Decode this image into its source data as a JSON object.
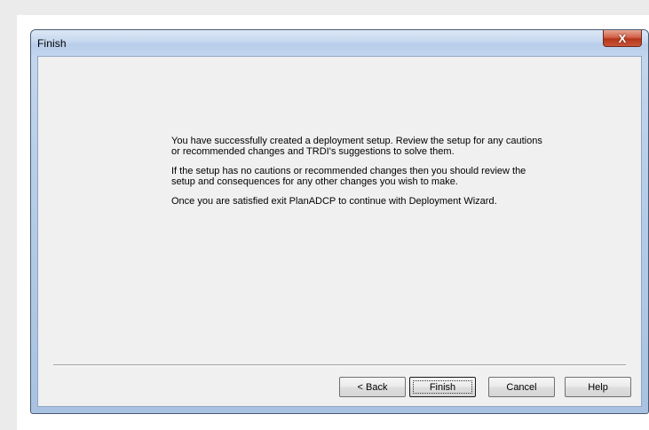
{
  "window": {
    "title": "Finish",
    "close_glyph": "X"
  },
  "message": {
    "paragraph1": "You have successfully created a deployment setup.   Review the setup for any cautions or recommended changes and TRDI's suggestions to solve them.",
    "paragraph2": "If the setup has no cautions or recommended changes then you should review the setup and consequences for any other changes you wish to make.",
    "paragraph3": "Once you are satisfied exit PlanADCP to continue with Deployment Wizard."
  },
  "buttons": {
    "back": "< Back",
    "finish": "Finish",
    "cancel": "Cancel",
    "help": "Help"
  }
}
